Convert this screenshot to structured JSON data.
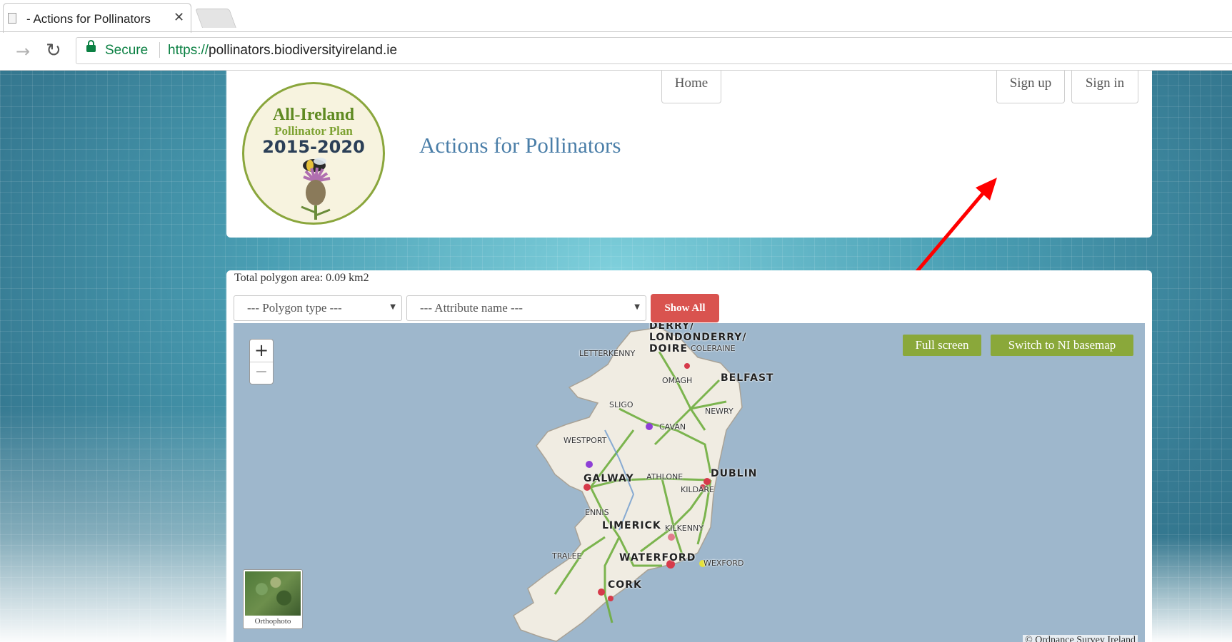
{
  "browser": {
    "tab_title": "- Actions for Pollinators",
    "secure_label": "Secure",
    "url_scheme": "https://",
    "url_host": "pollinators.biodiversityireland.ie"
  },
  "logo": {
    "line1": "All-Ireland",
    "line2": "Pollinator Plan",
    "line3": "2015-2020"
  },
  "header": {
    "title": "Actions for Pollinators",
    "nav": {
      "home": "Home",
      "sign_up": "Sign up",
      "sign_in": "Sign in"
    }
  },
  "filters": {
    "area_text": "Total polygon area: 0.09 km2",
    "polygon_type": "--- Polygon type ---",
    "attribute_name": "--- Attribute name ---",
    "show_all": "Show All"
  },
  "map": {
    "zoom_in": "+",
    "zoom_out": "−",
    "full_screen": "Full screen",
    "switch_basemap": "Switch to NI basemap",
    "orthophoto": "Orthophoto",
    "credit": "© Ordnance Survey Ireland",
    "towns": {
      "derry1": "DERRY/",
      "derry2": "LONDONDERRY/",
      "derry3": "DOIRE",
      "coleraine": "COLERAINE",
      "letterkenny": "LETTERKENNY",
      "omagh": "OMAGH",
      "belfast": "BELFAST",
      "sligo": "SLIGO",
      "newry": "NEWRY",
      "cavan": "CAVAN",
      "westport": "WESTPORT",
      "galway": "GALWAY",
      "athlone": "ATHLONE",
      "dublin": "DUBLIN",
      "kildare": "KILDARE",
      "ennis": "ENNIS",
      "limerick": "LIMERICK",
      "kilkenny": "KILKENNY",
      "tralee": "TRALEE",
      "waterford": "WATERFORD",
      "wexford": "WEXFORD",
      "cork": "CORK"
    }
  },
  "colors": {
    "accent_title": "#4a7ea8",
    "show_all_bg": "#d9534f",
    "map_button_bg": "#8aa83a",
    "secure_green": "#0b8043",
    "annotation_arrow": "#ff0000"
  }
}
